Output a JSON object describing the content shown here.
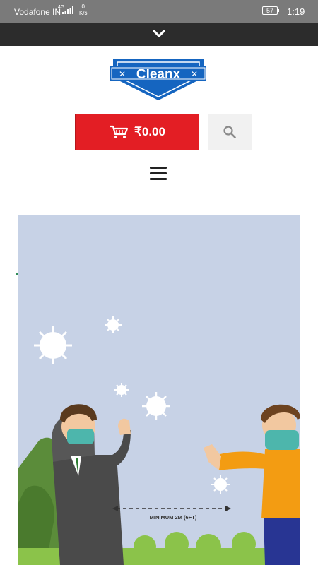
{
  "status_bar": {
    "carrier": "Vodafone IN",
    "network": "4G",
    "speed_value": "0",
    "speed_unit": "K/s",
    "battery": "57",
    "time": "1:19"
  },
  "header": {
    "logo_text": "Cleanx",
    "cart_total": "₹0.00"
  },
  "banner": {
    "distance_label": "MINIMUM 2M (6FT)"
  },
  "icons": [
    "chevron-down-icon",
    "cart-icon",
    "search-icon",
    "hamburger-menu-icon"
  ],
  "colors": {
    "cart_button": "#e31e24",
    "logo_blue": "#1565c0",
    "banner_bg": "#c7d2e6"
  }
}
